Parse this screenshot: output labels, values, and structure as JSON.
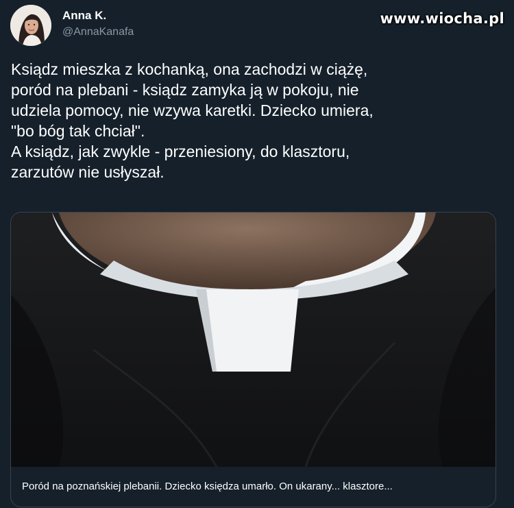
{
  "author": {
    "name": "Anna K.",
    "handle": "@AnnaKanafa"
  },
  "watermark": "www.wiocha.pl",
  "tweet": {
    "text": "Ksiądz mieszka z kochanką, ona zachodzi w ciążę,\nporód na plebani - ksiądz zamyka ją w pokoju, nie\nudziela pomocy, nie wzywa karetki. Dziecko umiera,\n\"bo bóg tak chciał\".\nA ksiądz, jak zwykle - przeniesiony, do klasztoru,\nzarzutów nie usłyszał."
  },
  "link_card": {
    "title": "Poród na poznańskiej plebanii. Dziecko księdza umarło. On ukarany... klasztore...",
    "image_subject": "priest-clerical-collar-photo"
  },
  "colors": {
    "background": "#15202b",
    "secondary_text": "#8b98a5",
    "border": "#38444d"
  }
}
